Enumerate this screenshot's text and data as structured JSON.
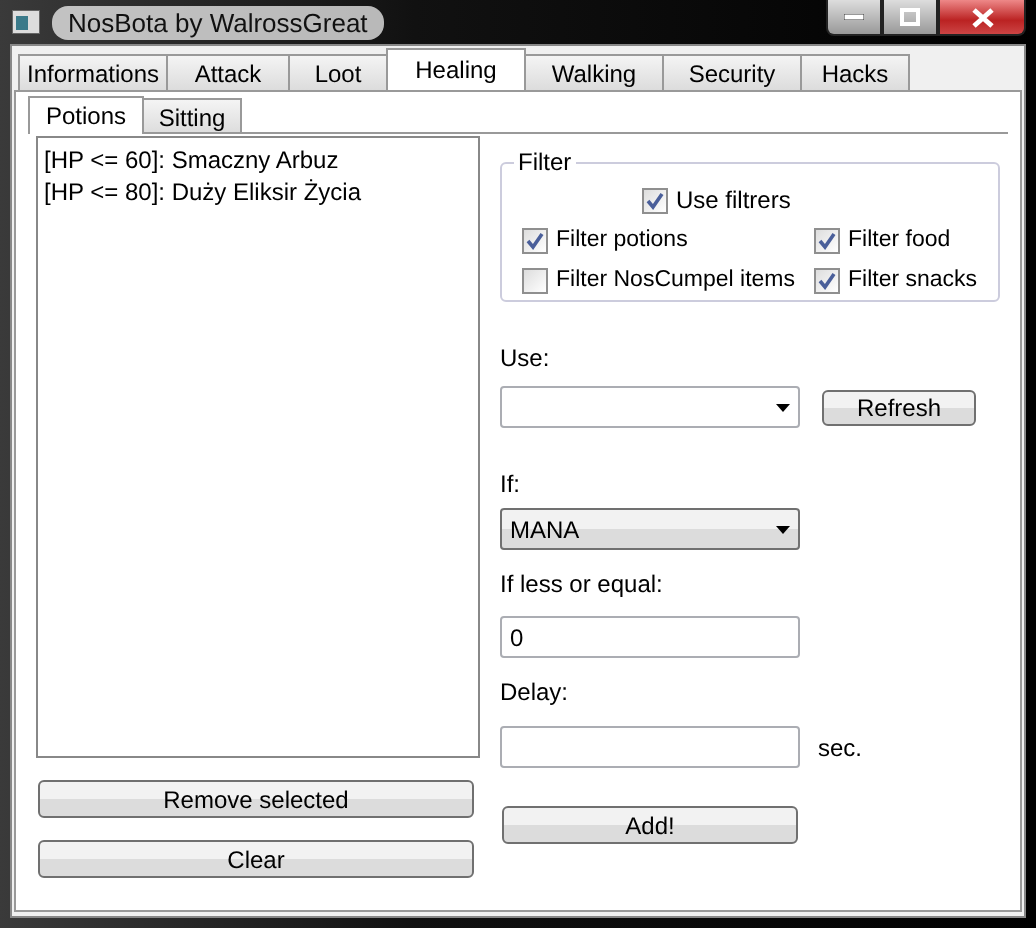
{
  "window": {
    "title": "NosBota by WalrossGreat"
  },
  "tabs": [
    {
      "label": "Informations",
      "selected": false
    },
    {
      "label": "Attack",
      "selected": false
    },
    {
      "label": "Loot",
      "selected": false
    },
    {
      "label": "Healing",
      "selected": true
    },
    {
      "label": "Walking",
      "selected": false
    },
    {
      "label": "Security",
      "selected": false
    },
    {
      "label": "Hacks",
      "selected": false
    }
  ],
  "subtabs": [
    {
      "label": "Potions",
      "selected": true
    },
    {
      "label": "Sitting",
      "selected": false
    }
  ],
  "potions": [
    "[HP <= 60]: Smaczny Arbuz",
    "[HP <= 80]: Duży Eliksir Życia"
  ],
  "list_buttons": [
    "Remove selected",
    "Clear"
  ],
  "filter": {
    "title": "Filter",
    "use_filters": {
      "label": "Use filtrers",
      "checked": true
    },
    "options": [
      {
        "label": "Filter potions",
        "checked": true
      },
      {
        "label": "Filter food",
        "checked": true
      },
      {
        "label": "Filter NosCumpel items",
        "checked": false
      },
      {
        "label": "Filter snacks",
        "checked": true
      }
    ]
  },
  "use": {
    "label": "Use:",
    "refresh": "Refresh"
  },
  "if": {
    "label": "If:",
    "value": "MANA"
  },
  "threshold": {
    "label": "If less or equal:",
    "value": "0"
  },
  "delay": {
    "label": "Delay:",
    "unit": "sec."
  },
  "add_button": "Add!"
}
